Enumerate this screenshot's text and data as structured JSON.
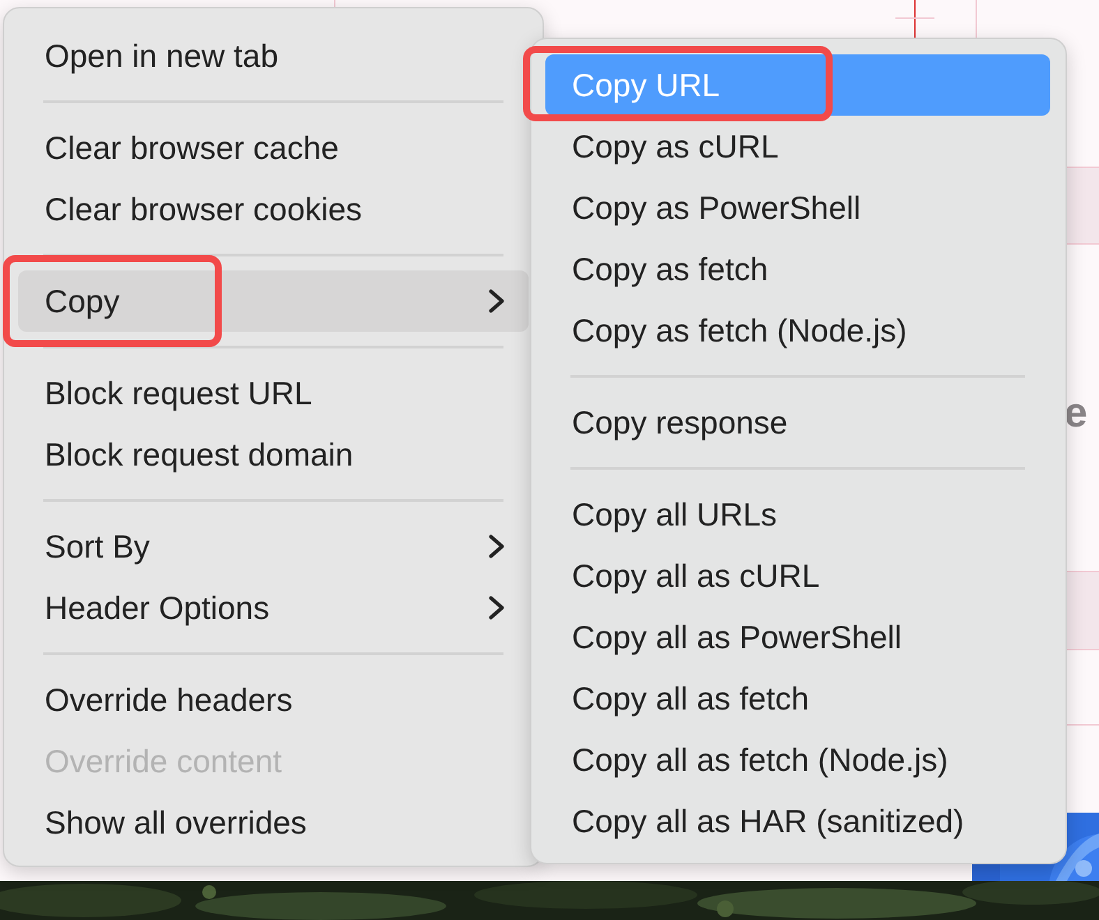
{
  "background": {
    "partial_text": "e"
  },
  "menu": {
    "items": [
      {
        "kind": "item",
        "label": "Open in new tab",
        "disabled": false,
        "selected": false,
        "submenu": false
      },
      {
        "kind": "separator"
      },
      {
        "kind": "item",
        "label": "Clear browser cache",
        "disabled": false,
        "selected": false,
        "submenu": false
      },
      {
        "kind": "item",
        "label": "Clear browser cookies",
        "disabled": false,
        "selected": false,
        "submenu": false
      },
      {
        "kind": "separator"
      },
      {
        "kind": "item",
        "label": "Copy",
        "disabled": false,
        "selected": true,
        "submenu": true
      },
      {
        "kind": "separator"
      },
      {
        "kind": "item",
        "label": "Block request URL",
        "disabled": false,
        "selected": false,
        "submenu": false
      },
      {
        "kind": "item",
        "label": "Block request domain",
        "disabled": false,
        "selected": false,
        "submenu": false
      },
      {
        "kind": "separator"
      },
      {
        "kind": "item",
        "label": "Sort By",
        "disabled": false,
        "selected": false,
        "submenu": true
      },
      {
        "kind": "item",
        "label": "Header Options",
        "disabled": false,
        "selected": false,
        "submenu": true
      },
      {
        "kind": "separator"
      },
      {
        "kind": "item",
        "label": "Override headers",
        "disabled": false,
        "selected": false,
        "submenu": false
      },
      {
        "kind": "item",
        "label": "Override content",
        "disabled": true,
        "selected": false,
        "submenu": false
      },
      {
        "kind": "item",
        "label": "Show all overrides",
        "disabled": false,
        "selected": false,
        "submenu": false
      }
    ]
  },
  "submenu": {
    "items": [
      {
        "kind": "item",
        "label": "Copy URL",
        "disabled": false,
        "selected": true,
        "submenu": false
      },
      {
        "kind": "item",
        "label": "Copy as cURL",
        "disabled": false,
        "selected": false,
        "submenu": false
      },
      {
        "kind": "item",
        "label": "Copy as PowerShell",
        "disabled": false,
        "selected": false,
        "submenu": false
      },
      {
        "kind": "item",
        "label": "Copy as fetch",
        "disabled": false,
        "selected": false,
        "submenu": false
      },
      {
        "kind": "item",
        "label": "Copy as fetch (Node.js)",
        "disabled": false,
        "selected": false,
        "submenu": false
      },
      {
        "kind": "separator"
      },
      {
        "kind": "item",
        "label": "Copy response",
        "disabled": false,
        "selected": false,
        "submenu": false
      },
      {
        "kind": "separator"
      },
      {
        "kind": "item",
        "label": "Copy all URLs",
        "disabled": false,
        "selected": false,
        "submenu": false
      },
      {
        "kind": "item",
        "label": "Copy all as cURL",
        "disabled": false,
        "selected": false,
        "submenu": false
      },
      {
        "kind": "item",
        "label": "Copy all as PowerShell",
        "disabled": false,
        "selected": false,
        "submenu": false
      },
      {
        "kind": "item",
        "label": "Copy all as fetch",
        "disabled": false,
        "selected": false,
        "submenu": false
      },
      {
        "kind": "item",
        "label": "Copy all as fetch (Node.js)",
        "disabled": false,
        "selected": false,
        "submenu": false
      },
      {
        "kind": "item",
        "label": "Copy all as HAR (sanitized)",
        "disabled": false,
        "selected": false,
        "submenu": false
      }
    ]
  }
}
